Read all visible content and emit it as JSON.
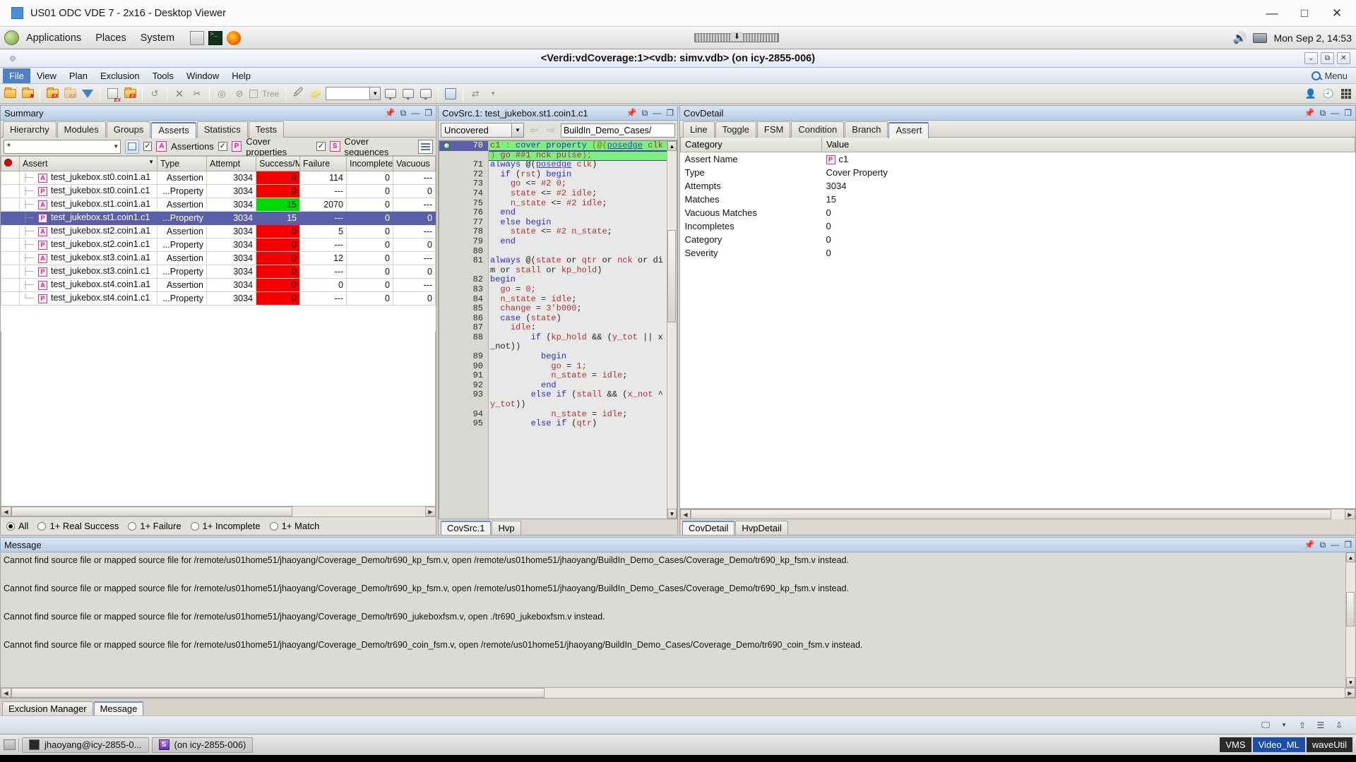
{
  "viewer": {
    "title": "US01 ODC VDE 7 - 2x16 - Desktop Viewer",
    "minimize": "—",
    "maximize": "□",
    "close": "✕"
  },
  "gnome_panel": {
    "menus": [
      "Applications",
      "Places",
      "System"
    ],
    "tray": [
      "files-icon",
      "terminal-icon",
      "firefox-icon"
    ],
    "clock": "Mon Sep 2, 14:53"
  },
  "app_window": {
    "title": "<Verdi:vdCoverage:1><vdb: simv.vdb> (on icy-2855-006)",
    "controls": [
      "collapse-icon",
      "restore-icon",
      "close-icon"
    ]
  },
  "menubar": {
    "items": [
      "File",
      "View",
      "Plan",
      "Exclusion",
      "Tools",
      "Window",
      "Help"
    ],
    "active": "File",
    "search_label": "Menu"
  },
  "toolbar": {
    "tree_label": "Tree",
    "combo_value": ""
  },
  "summary": {
    "panel_title": "Summary",
    "tabs": [
      "Hierarchy",
      "Modules",
      "Groups",
      "Asserts",
      "Statistics",
      "Tests"
    ],
    "selected_tab": "Asserts",
    "filter_value": "*",
    "checkbox_assertions": "Assertions",
    "checkbox_cover_properties": "Cover properties",
    "checkbox_cover_sequences": "Cover sequences",
    "tag_a": "A",
    "tag_p": "P",
    "tag_s": "S",
    "check_mark": "✓",
    "columns": [
      "",
      "Assert",
      "Type",
      "Attempt",
      "Success/Ma",
      "Failure",
      "Incomplete",
      "Vacuous"
    ],
    "rows": [
      {
        "tag": "A",
        "name": "test_jukebox.st0.coin1.a1",
        "type": "Assertion",
        "attempt": "3034",
        "success": "0",
        "success_state": "red",
        "failure": "114",
        "incomplete": "0",
        "vacuous": "---",
        "selected": false
      },
      {
        "tag": "P",
        "name": "test_jukebox.st0.coin1.c1",
        "type": "...Property",
        "attempt": "3034",
        "success": "0",
        "success_state": "red",
        "failure": "---",
        "incomplete": "0",
        "vacuous": "0",
        "selected": false
      },
      {
        "tag": "A",
        "name": "test_jukebox.st1.coin1.a1",
        "type": "Assertion",
        "attempt": "3034",
        "success": "15",
        "success_state": "green",
        "failure": "2070",
        "incomplete": "0",
        "vacuous": "---",
        "selected": false
      },
      {
        "tag": "P",
        "name": "test_jukebox.st1.coin1.c1",
        "type": "...Property",
        "attempt": "3034",
        "success": "15",
        "success_state": "green",
        "failure": "---",
        "incomplete": "0",
        "vacuous": "0",
        "selected": true
      },
      {
        "tag": "A",
        "name": "test_jukebox.st2.coin1.a1",
        "type": "Assertion",
        "attempt": "3034",
        "success": "0",
        "success_state": "red",
        "failure": "5",
        "incomplete": "0",
        "vacuous": "---",
        "selected": false
      },
      {
        "tag": "P",
        "name": "test_jukebox.st2.coin1.c1",
        "type": "...Property",
        "attempt": "3034",
        "success": "0",
        "success_state": "red",
        "failure": "---",
        "incomplete": "0",
        "vacuous": "0",
        "selected": false
      },
      {
        "tag": "A",
        "name": "test_jukebox.st3.coin1.a1",
        "type": "Assertion",
        "attempt": "3034",
        "success": "0",
        "success_state": "red",
        "failure": "12",
        "incomplete": "0",
        "vacuous": "---",
        "selected": false
      },
      {
        "tag": "P",
        "name": "test_jukebox.st3.coin1.c1",
        "type": "...Property",
        "attempt": "3034",
        "success": "0",
        "success_state": "red",
        "failure": "---",
        "incomplete": "0",
        "vacuous": "0",
        "selected": false
      },
      {
        "tag": "A",
        "name": "test_jukebox.st4.coin1.a1",
        "type": "Assertion",
        "attempt": "3034",
        "success": "0",
        "success_state": "red",
        "failure": "0",
        "incomplete": "0",
        "vacuous": "---",
        "selected": false
      },
      {
        "tag": "P",
        "name": "test_jukebox.st4.coin1.c1",
        "type": "...Property",
        "attempt": "3034",
        "success": "0",
        "success_state": "red",
        "failure": "---",
        "incomplete": "0",
        "vacuous": "0",
        "selected": false
      }
    ],
    "radios": [
      "All",
      "1+ Real Success",
      "1+ Failure",
      "1+ Incomplete",
      "1+ Match"
    ],
    "radio_selected": "All"
  },
  "source": {
    "panel_title": "CovSrc.1: test_jukebox.st1.coin1.c1",
    "mode_value": "Uncovered",
    "path_value": "BuildIn_Demo_Cases/",
    "bottom_tabs": [
      "CovSrc.1",
      "Hvp"
    ],
    "bottom_tab_selected": "CovSrc.1",
    "lines": [
      {
        "no": "70",
        "covered": true,
        "highlight": true,
        "text": "c1 : cover property (@(posedge clk"
      },
      {
        "no": "",
        "covered": false,
        "highlight": true,
        "text": ") go ##1 nck pulse);"
      },
      {
        "no": "71",
        "covered": false,
        "highlight": false,
        "text": "always @(posedge clk)"
      },
      {
        "no": "72",
        "covered": false,
        "highlight": false,
        "text": "  if (rst) begin"
      },
      {
        "no": "73",
        "covered": false,
        "highlight": false,
        "text": "    go <= #2 0;"
      },
      {
        "no": "74",
        "covered": false,
        "highlight": false,
        "text": "    state <= #2 idle;"
      },
      {
        "no": "75",
        "covered": false,
        "highlight": false,
        "text": "    n_state <= #2 idle;"
      },
      {
        "no": "76",
        "covered": false,
        "highlight": false,
        "text": "  end"
      },
      {
        "no": "77",
        "covered": false,
        "highlight": false,
        "text": "  else begin"
      },
      {
        "no": "78",
        "covered": false,
        "highlight": false,
        "text": "    state <= #2 n_state;"
      },
      {
        "no": "79",
        "covered": false,
        "highlight": false,
        "text": "  end"
      },
      {
        "no": "80",
        "covered": false,
        "highlight": false,
        "text": ""
      },
      {
        "no": "81",
        "covered": false,
        "highlight": false,
        "text": "always @(state or qtr or nck or di"
      },
      {
        "no": "",
        "covered": false,
        "highlight": false,
        "text": "m or stall or kp_hold)"
      },
      {
        "no": "82",
        "covered": false,
        "highlight": false,
        "text": "begin"
      },
      {
        "no": "83",
        "covered": false,
        "highlight": false,
        "text": "  go = 0;"
      },
      {
        "no": "84",
        "covered": false,
        "highlight": false,
        "text": "  n_state = idle;"
      },
      {
        "no": "85",
        "covered": false,
        "highlight": false,
        "text": "  change = 3'b000;"
      },
      {
        "no": "86",
        "covered": false,
        "highlight": false,
        "text": "  case (state)"
      },
      {
        "no": "87",
        "covered": false,
        "highlight": false,
        "text": "    idle:"
      },
      {
        "no": "88",
        "covered": false,
        "highlight": false,
        "text": "        if (kp_hold && (y_tot || x"
      },
      {
        "no": "",
        "covered": false,
        "highlight": false,
        "text": "_not))"
      },
      {
        "no": "89",
        "covered": false,
        "highlight": false,
        "text": "          begin"
      },
      {
        "no": "90",
        "covered": false,
        "highlight": false,
        "text": "            go = 1;"
      },
      {
        "no": "91",
        "covered": false,
        "highlight": false,
        "text": "            n_state = idle;"
      },
      {
        "no": "92",
        "covered": false,
        "highlight": false,
        "text": "          end"
      },
      {
        "no": "93",
        "covered": false,
        "highlight": false,
        "text": "        else if (stall && (x_not ^"
      },
      {
        "no": "",
        "covered": false,
        "highlight": false,
        "text": "y_tot))"
      },
      {
        "no": "94",
        "covered": false,
        "highlight": false,
        "text": "            n_state = idle;"
      },
      {
        "no": "95",
        "covered": false,
        "highlight": false,
        "text": "        else if (qtr)"
      }
    ]
  },
  "detail": {
    "panel_title": "CovDetail",
    "tabs": [
      "Line",
      "Toggle",
      "FSM",
      "Condition",
      "Branch",
      "Assert"
    ],
    "selected_tab": "Assert",
    "columns": [
      "Category",
      "Value"
    ],
    "rows": [
      {
        "category": "Assert Name",
        "value": "c1",
        "tag": "P"
      },
      {
        "category": "Type",
        "value": "Cover Property",
        "tag": ""
      },
      {
        "category": "Attempts",
        "value": "3034",
        "tag": ""
      },
      {
        "category": "Matches",
        "value": "15",
        "tag": ""
      },
      {
        "category": "Vacuous Matches",
        "value": "0",
        "tag": ""
      },
      {
        "category": "Incompletes",
        "value": "0",
        "tag": ""
      },
      {
        "category": "Category",
        "value": "0",
        "tag": ""
      },
      {
        "category": "Severity",
        "value": "0",
        "tag": ""
      }
    ],
    "bottom_tabs": [
      "CovDetail",
      "HvpDetail"
    ],
    "bottom_tab_selected": "CovDetail"
  },
  "message": {
    "panel_title": "Message",
    "lines": [
      "Cannot find source file or mapped source file for /remote/us01home51/jhaoyang/Coverage_Demo/tr690_kp_fsm.v, open /remote/us01home51/jhaoyang/BuildIn_Demo_Cases/Coverage_Demo/tr690_kp_fsm.v instead.",
      "Cannot find source file or mapped source file for /remote/us01home51/jhaoyang/Coverage_Demo/tr690_kp_fsm.v, open /remote/us01home51/jhaoyang/BuildIn_Demo_Cases/Coverage_Demo/tr690_kp_fsm.v instead.",
      "Cannot find source file or mapped source file for /remote/us01home51/jhaoyang/Coverage_Demo/tr690_jukeboxfsm.v, open ./tr690_jukeboxfsm.v instead.",
      "Cannot find source file or mapped source file for /remote/us01home51/jhaoyang/Coverage_Demo/tr690_coin_fsm.v, open /remote/us01home51/jhaoyang/BuildIn_Demo_Cases/Coverage_Demo/tr690_coin_fsm.v instead."
    ],
    "bottom_tabs": [
      "Exclusion Manager",
      "Message"
    ],
    "bottom_tab_selected": "Message"
  },
  "taskbar": {
    "items": [
      {
        "label": "jhaoyang@icy-2855-0...",
        "icon": "terminal-icon"
      },
      {
        "label": "(on icy-2855-006)",
        "icon": "verdi-icon"
      }
    ],
    "right_pills": [
      {
        "label": "VMS",
        "style": "dark"
      },
      {
        "label": "Video_ML",
        "style": "blue"
      },
      {
        "label": "waveUtil",
        "style": "dark"
      }
    ]
  },
  "colors": {
    "accent": "#4d7fc4",
    "selection": "#5b5ea8",
    "fail_red": "#f50000",
    "pass_green": "#00d900",
    "cover_highlight": "#7cf07c",
    "tag_pink": "#d11f7f"
  }
}
